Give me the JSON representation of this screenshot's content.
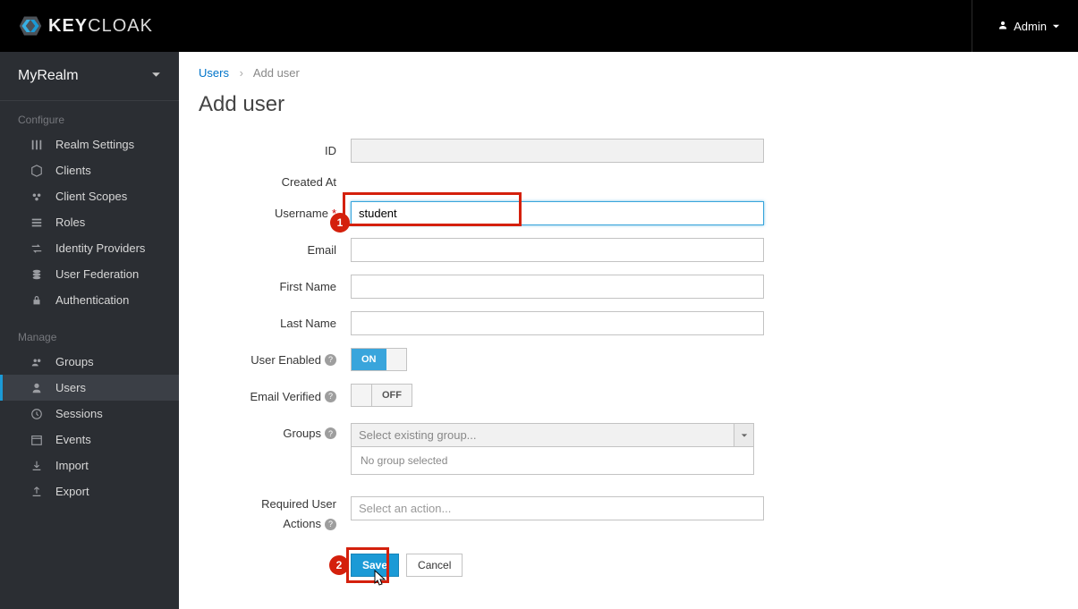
{
  "header": {
    "brand_bold": "KEY",
    "brand_light": "CLOAK",
    "user_label": "Admin"
  },
  "sidebar": {
    "realm": "MyRealm",
    "section_configure": "Configure",
    "section_manage": "Manage",
    "configure_items": [
      {
        "label": "Realm Settings"
      },
      {
        "label": "Clients"
      },
      {
        "label": "Client Scopes"
      },
      {
        "label": "Roles"
      },
      {
        "label": "Identity Providers"
      },
      {
        "label": "User Federation"
      },
      {
        "label": "Authentication"
      }
    ],
    "manage_items": [
      {
        "label": "Groups"
      },
      {
        "label": "Users"
      },
      {
        "label": "Sessions"
      },
      {
        "label": "Events"
      },
      {
        "label": "Import"
      },
      {
        "label": "Export"
      }
    ]
  },
  "breadcrumb": {
    "link": "Users",
    "current": "Add user"
  },
  "page": {
    "title": "Add user",
    "labels": {
      "id": "ID",
      "created_at": "Created At",
      "username": "Username",
      "email": "Email",
      "first_name": "First Name",
      "last_name": "Last Name",
      "user_enabled": "User Enabled",
      "email_verified": "Email Verified",
      "groups": "Groups",
      "required_actions_l1": "Required User",
      "required_actions_l2": "Actions"
    },
    "values": {
      "username": "student",
      "user_enabled": "ON",
      "email_verified": "OFF",
      "groups_placeholder": "Select existing group...",
      "groups_msg": "No group selected",
      "actions_placeholder": "Select an action..."
    },
    "buttons": {
      "save": "Save",
      "cancel": "Cancel"
    }
  },
  "annotations": {
    "callout1": "1",
    "callout2": "2"
  }
}
